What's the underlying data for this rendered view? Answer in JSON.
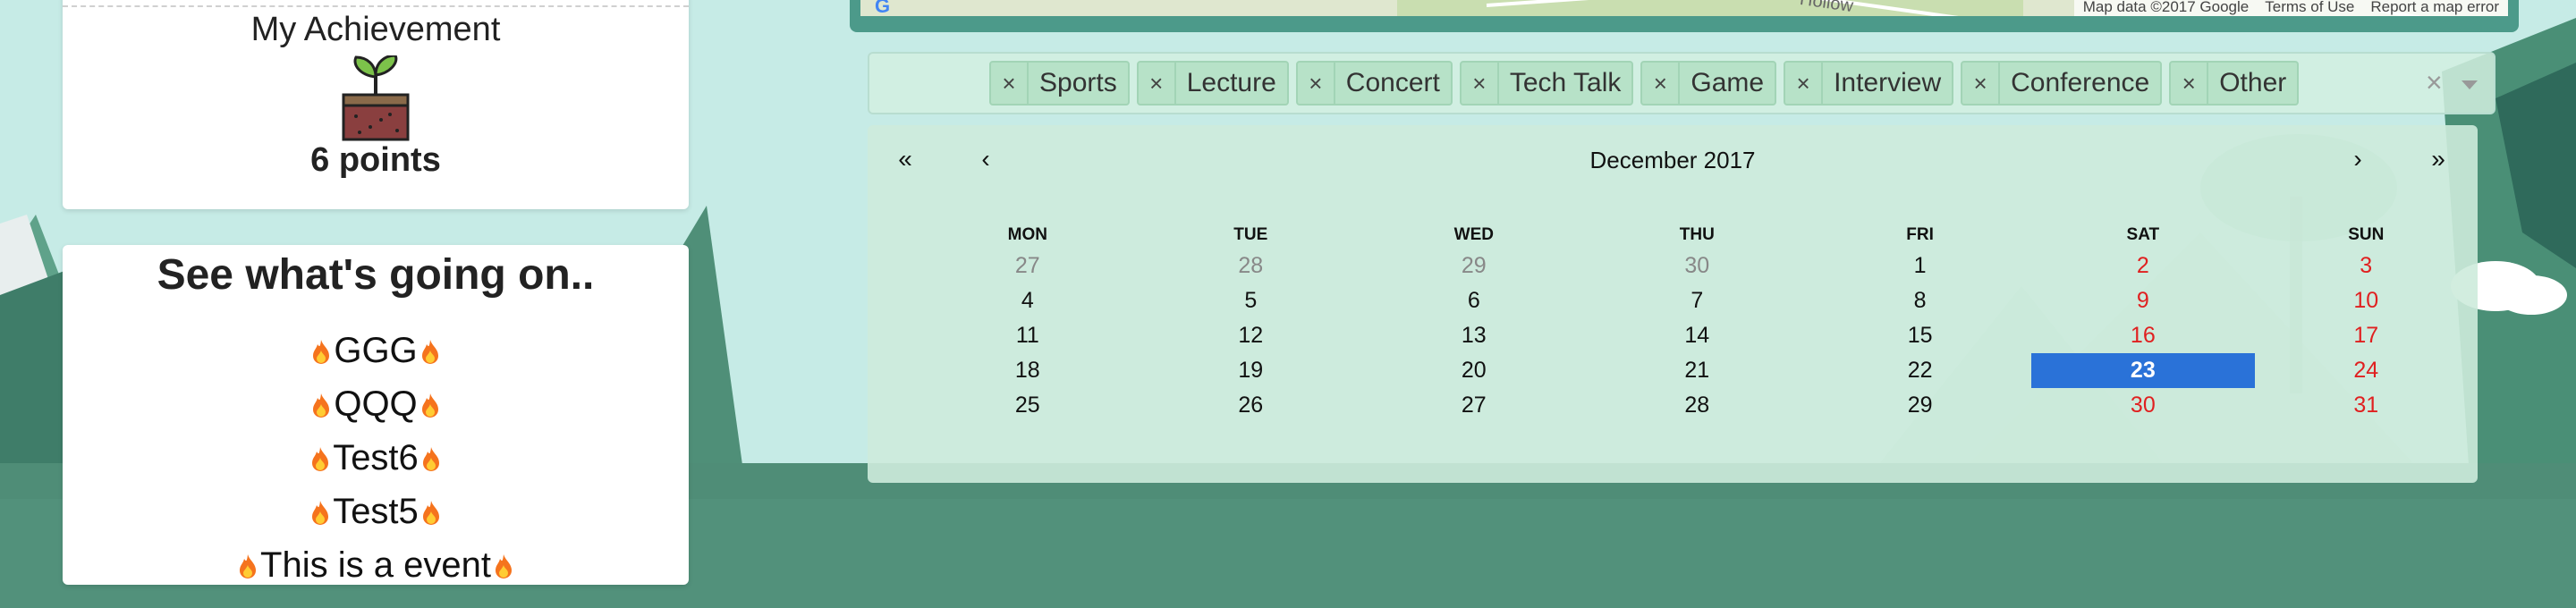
{
  "achievement": {
    "title": "My Achievement",
    "icon": "sprout-icon",
    "points": "6 points"
  },
  "events": {
    "title": "See what's going on..",
    "items": [
      "GGG",
      "QQQ",
      "Test6",
      "Test5",
      "This is a event"
    ],
    "icon": "fire-icon"
  },
  "map": {
    "attribution": "Map data ©2017 Google",
    "terms": "Terms of Use",
    "report": "Report a map error",
    "street": "Hollow"
  },
  "tags": [
    {
      "label": "Sports"
    },
    {
      "label": "Lecture"
    },
    {
      "label": "Concert"
    },
    {
      "label": "Tech Talk"
    },
    {
      "label": "Game"
    },
    {
      "label": "Interview"
    },
    {
      "label": "Conference"
    },
    {
      "label": "Other"
    }
  ],
  "calendar": {
    "title": "December 2017",
    "nav": {
      "prev_year": "«",
      "prev_month": "‹",
      "next_month": "›",
      "next_year": "»"
    },
    "weekdays": [
      "MON",
      "TUE",
      "WED",
      "THU",
      "FRI",
      "SAT",
      "SUN"
    ],
    "weeks": [
      [
        "27",
        "28",
        "29",
        "30",
        "1",
        "2",
        "3"
      ],
      [
        "4",
        "5",
        "6",
        "7",
        "8",
        "9",
        "10"
      ],
      [
        "11",
        "12",
        "13",
        "14",
        "15",
        "16",
        "17"
      ],
      [
        "18",
        "19",
        "20",
        "21",
        "22",
        "23",
        "24"
      ],
      [
        "25",
        "26",
        "27",
        "28",
        "29",
        "30",
        "31"
      ]
    ],
    "selected": "23",
    "colors": {
      "selected": "#2a72d8",
      "weekend": "#e02020",
      "other_month": "#888888"
    }
  }
}
